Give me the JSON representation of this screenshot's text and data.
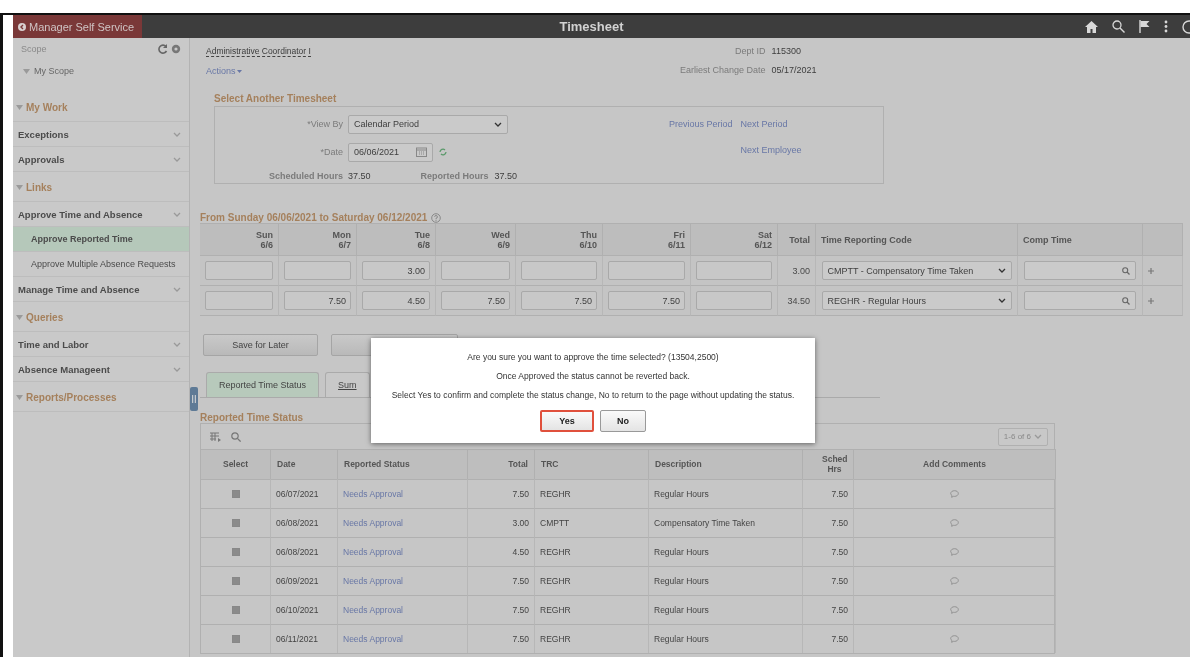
{
  "header": {
    "back_button": "Manager Self Service",
    "title": "Timesheet"
  },
  "sidebar": {
    "scope_label": "Scope",
    "scope_item": "My Scope",
    "sections": [
      {
        "title": "My Work",
        "expanded": true,
        "items": [
          {
            "label": "Exceptions",
            "kind": "group",
            "selected": false
          },
          {
            "label": "Approvals",
            "kind": "group",
            "selected": false
          }
        ]
      },
      {
        "title": "Links",
        "expanded": true,
        "items": [
          {
            "label": "Approve Time and Absence",
            "kind": "group",
            "selected": false
          },
          {
            "label": "Approve Reported Time",
            "kind": "link",
            "selected": true
          },
          {
            "label": "Approve Multiple Absence Requests",
            "kind": "link",
            "selected": false
          },
          {
            "label": "Manage Time and Absence",
            "kind": "group",
            "selected": false
          }
        ]
      },
      {
        "title": "Queries",
        "expanded": true,
        "items": [
          {
            "label": "Time and Labor",
            "kind": "group",
            "selected": false
          },
          {
            "label": "Absence Manageent",
            "kind": "group",
            "selected": false
          }
        ]
      },
      {
        "title": "Reports/Processes",
        "expanded": true
      }
    ]
  },
  "employee": {
    "job_title": "Administrative Coordinator I",
    "actions": "Actions",
    "dept_id_label": "Dept ID",
    "dept_id": "115300",
    "change_date_label": "Earliest Change Date",
    "change_date": "05/17/2021"
  },
  "select_timesheet": {
    "title": "Select Another Timesheet",
    "view_by_label": "*View By",
    "view_by": "Calendar Period",
    "date_label": "*Date",
    "date": "06/06/2021",
    "scheduled_label": "Scheduled Hours",
    "scheduled": "37.50",
    "reported_label": "Reported Hours",
    "reported": "37.50",
    "previous_period": "Previous Period",
    "next_period": "Next Period",
    "next_employee": "Next Employee"
  },
  "week": {
    "title": "From Sunday 06/06/2021 to Saturday 06/12/2021",
    "days": [
      {
        "day": "Sun",
        "date": "6/6"
      },
      {
        "day": "Mon",
        "date": "6/7"
      },
      {
        "day": "Tue",
        "date": "6/8"
      },
      {
        "day": "Wed",
        "date": "6/9"
      },
      {
        "day": "Thu",
        "date": "6/10"
      },
      {
        "day": "Fri",
        "date": "6/11"
      },
      {
        "day": "Sat",
        "date": "6/12"
      }
    ],
    "total_heading": "Total",
    "code_heading": "Time Reporting Code",
    "comp_heading": "Comp Time",
    "rows": [
      {
        "hours": [
          {
            "kind": "empty"
          },
          {
            "kind": "empty"
          },
          {
            "kind": "filled",
            "value": "3.00"
          },
          {
            "kind": "empty"
          },
          {
            "kind": "empty"
          },
          {
            "kind": "empty"
          },
          {
            "kind": "empty"
          }
        ],
        "total": "3.00",
        "code": "CMPTT - Compensatory Time Taken"
      },
      {
        "hours": [
          {
            "kind": "empty"
          },
          {
            "kind": "filled",
            "value": "7.50"
          },
          {
            "kind": "filled",
            "value": "4.50"
          },
          {
            "kind": "filled",
            "value": "7.50"
          },
          {
            "kind": "filled",
            "value": "7.50"
          },
          {
            "kind": "filled",
            "value": "7.50"
          },
          {
            "kind": "empty"
          }
        ],
        "total": "34.50",
        "code": "REGHR - Regular Hours"
      }
    ]
  },
  "save_button": "Save for Later",
  "tabs": [
    {
      "label": "Reported Time Status",
      "selected": true
    },
    {
      "label": "Sum",
      "selected": false
    }
  ],
  "status": {
    "title": "Reported Time Status",
    "pager": "1-6 of 6",
    "columns": [
      "Select",
      "Date",
      "Reported Status",
      "Total",
      "TRC",
      "Description",
      "Sched Hrs",
      "Add Comments"
    ],
    "rows": [
      {
        "checked": true,
        "date": "06/07/2021",
        "status": "Needs Approval",
        "total": "7.50",
        "trc": "REGHR",
        "description": "Regular Hours",
        "sched": "7.50"
      },
      {
        "checked": true,
        "date": "06/08/2021",
        "status": "Needs Approval",
        "total": "3.00",
        "trc": "CMPTT",
        "description": "Compensatory Time Taken",
        "sched": "7.50"
      },
      {
        "checked": true,
        "date": "06/08/2021",
        "status": "Needs Approval",
        "total": "4.50",
        "trc": "REGHR",
        "description": "Regular Hours",
        "sched": "7.50"
      },
      {
        "checked": true,
        "date": "06/09/2021",
        "status": "Needs Approval",
        "total": "7.50",
        "trc": "REGHR",
        "description": "Regular Hours",
        "sched": "7.50"
      },
      {
        "checked": true,
        "date": "06/10/2021",
        "status": "Needs Approval",
        "total": "7.50",
        "trc": "REGHR",
        "description": "Regular Hours",
        "sched": "7.50"
      },
      {
        "checked": true,
        "date": "06/11/2021",
        "status": "Needs Approval",
        "total": "7.50",
        "trc": "REGHR",
        "description": "Regular Hours",
        "sched": "7.50"
      }
    ]
  },
  "dialog": {
    "lines": [
      "Are you sure you want to approve the time selected? (13504,2500)",
      "Once Approved the status cannot be reverted back.",
      "Select Yes to confirm and complete the status change, No to return to the page without updating the status."
    ],
    "buttons": [
      {
        "label": "Yes",
        "focused": true
      },
      {
        "label": "No",
        "focused": false
      }
    ]
  }
}
